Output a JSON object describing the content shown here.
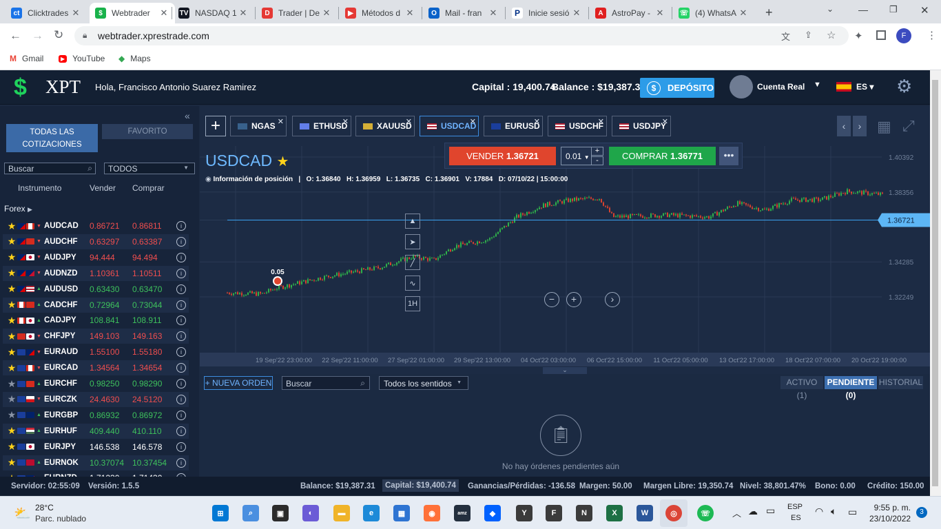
{
  "browser": {
    "tabs": [
      {
        "title": "Clicktrades",
        "color": "#1a73e8",
        "glyph": "ct"
      },
      {
        "title": "Webtrader",
        "color": "#19b24b",
        "glyph": "$"
      },
      {
        "title": "NASDAQ 1",
        "color": "#131722",
        "glyph": "TV"
      },
      {
        "title": "Trader | De",
        "color": "#e53935",
        "glyph": "D"
      },
      {
        "title": "Métodos d",
        "color": "#e53935",
        "glyph": "▶"
      },
      {
        "title": "Mail - fran",
        "color": "#0a62c9",
        "glyph": "O"
      },
      {
        "title": "Inicie sesió",
        "color": "#ffffff",
        "glyph": "P"
      },
      {
        "title": "AstroPay -",
        "color": "#e02020",
        "glyph": "A"
      },
      {
        "title": "(4) WhatsA",
        "color": "#25d366",
        "glyph": "☏"
      }
    ],
    "new_tab": "+",
    "url": "webtrader.xprestrade.com",
    "bookmarks": [
      "Gmail",
      "YouTube",
      "Maps"
    ],
    "profile_initial": "F"
  },
  "header": {
    "logo": "XPT",
    "greeting": "Hola, Francisco Antonio Suarez Ramirez",
    "capital_label": "Capital :",
    "capital_value": "19,400.74",
    "balance_label": "Balance :",
    "balance_value": "$19,387.31",
    "deposit_label": "DEPÓSITO",
    "account_label": "Cuenta Real",
    "lang": "ES"
  },
  "sidebar": {
    "tab_all": "TODAS LAS COTIZACIONES",
    "tab_fav": "FAVORITO",
    "search_placeholder": "Buscar",
    "filter": "TODOS",
    "col_instrument": "Instrumento",
    "col_sell": "Vender",
    "col_buy": "Comprar",
    "group": "Forex",
    "quotes": [
      {
        "sym": "AUDCAD",
        "sell": "0.86721",
        "buy": "0.86811",
        "dir": "down",
        "fav": true
      },
      {
        "sym": "AUDCHF",
        "sell": "0.63297",
        "buy": "0.63387",
        "dir": "down",
        "fav": true
      },
      {
        "sym": "AUDJPY",
        "sell": "94.444",
        "buy": "94.494",
        "dir": "down",
        "fav": true
      },
      {
        "sym": "AUDNZD",
        "sell": "1.10361",
        "buy": "1.10511",
        "dir": "down",
        "fav": true
      },
      {
        "sym": "AUDUSD",
        "sell": "0.63430",
        "buy": "0.63470",
        "dir": "up",
        "fav": true
      },
      {
        "sym": "CADCHF",
        "sell": "0.72964",
        "buy": "0.73044",
        "dir": "up",
        "fav": true
      },
      {
        "sym": "CADJPY",
        "sell": "108.841",
        "buy": "108.911",
        "dir": "up",
        "fav": true
      },
      {
        "sym": "CHFJPY",
        "sell": "149.103",
        "buy": "149.163",
        "dir": "down",
        "fav": true
      },
      {
        "sym": "EURAUD",
        "sell": "1.55100",
        "buy": "1.55180",
        "dir": "down",
        "fav": true
      },
      {
        "sym": "EURCAD",
        "sell": "1.34564",
        "buy": "1.34654",
        "dir": "down",
        "fav": true
      },
      {
        "sym": "EURCHF",
        "sell": "0.98250",
        "buy": "0.98290",
        "dir": "up",
        "fav": false
      },
      {
        "sym": "EURCZK",
        "sell": "24.4630",
        "buy": "24.5120",
        "dir": "down",
        "fav": false
      },
      {
        "sym": "EURGBP",
        "sell": "0.86932",
        "buy": "0.86972",
        "dir": "up",
        "fav": false
      },
      {
        "sym": "EURHUF",
        "sell": "409.440",
        "buy": "410.110",
        "dir": "up",
        "fav": true
      },
      {
        "sym": "EURJPY",
        "sell": "146.538",
        "buy": "146.578",
        "dir": "none",
        "fav": true
      },
      {
        "sym": "EURNOK",
        "sell": "10.37074",
        "buy": "10.37454",
        "dir": "up",
        "fav": true
      },
      {
        "sym": "EURNZD",
        "sell": "1.71230",
        "buy": "1.71430",
        "dir": "none",
        "fav": true
      }
    ]
  },
  "instrument_tabs": [
    "NGAS",
    "ETHUSD",
    "XAUUSD",
    "USDCAD",
    "EURUSD",
    "USDCHF",
    "USDJPY"
  ],
  "chart": {
    "symbol": "USDCAD",
    "position_info": "Información de posición",
    "ohlc": {
      "O": "1.36840",
      "H": "1.36959",
      "L": "1.36735",
      "C": "1.36901",
      "V": "17884"
    },
    "datetime": "07/10/22 | 15:00:00",
    "sell_label": "VENDER",
    "sell_price": "1.36721",
    "lot": "0.01",
    "buy_label": "COMPRAR",
    "buy_price": "1.36771",
    "timeframe": "1H",
    "order_marker": "0.05",
    "current_price": "1.36721",
    "y_ticks": [
      "1.40392",
      "1.38356",
      "1.36721",
      "1.34285",
      "1.32249"
    ],
    "x_ticks": [
      "19 Sep'22 23:00:00",
      "22 Sep'22 11:00:00",
      "27 Sep'22 01:00:00",
      "29 Sep'22 13:00:00",
      "04 Oct'22 03:00:00",
      "06 Oct'22 15:00:00",
      "11 Oct'22 05:00:00",
      "13 Oct'22 17:00:00",
      "18 Oct'22 07:00:00",
      "20 Oct'22 19:00:00"
    ]
  },
  "orders": {
    "new_order": "NUEVA ORDEN",
    "search_placeholder": "Buscar",
    "direction": "Todos los sentidos",
    "tab_active": "ACTIVO (1)",
    "tab_pending": "PENDIENTE (0)",
    "tab_history": "HISTORIAL",
    "empty": "No hay órdenes pendientes aún"
  },
  "status": {
    "server": "Servidor: 02:55:09",
    "version": "Versión: 1.5.5",
    "balance": "Balance:  $19,387.31",
    "capital": "Capital:  $19,400.74",
    "pnl": "Ganancias/Pérdidas: -136.58",
    "margin": "Margen: 50.00",
    "free_margin": "Margen Libre: 19,350.74",
    "level": "Nivel: 38,801.47%",
    "bonus": "Bono: 0.00",
    "credit": "Crédito: 150.00"
  },
  "taskbar": {
    "temp": "28°C",
    "weather": "Parc. nublado",
    "lang1": "ESP",
    "lang2": "ES",
    "time": "9:55 p. m.",
    "date": "23/10/2022",
    "notif": "3"
  }
}
